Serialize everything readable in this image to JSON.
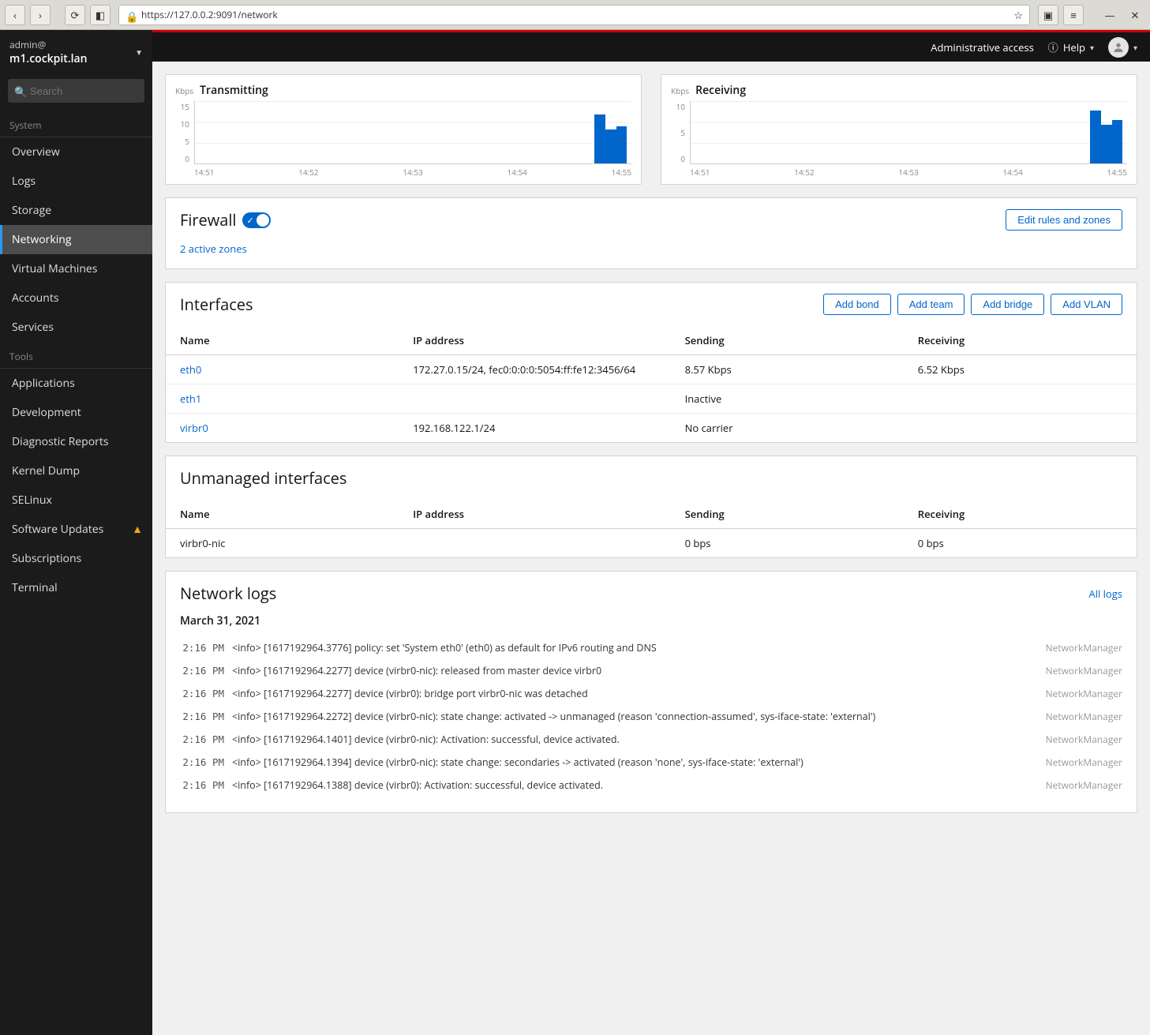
{
  "browser": {
    "url": "https://127.0.0.2:9091/network"
  },
  "topbar": {
    "admin_access": "Administrative access",
    "help": "Help"
  },
  "host": {
    "user": "admin@",
    "hostname": "m1.cockpit.lan"
  },
  "search": {
    "placeholder": "Search"
  },
  "nav": {
    "section_system": "System",
    "overview": "Overview",
    "logs": "Logs",
    "storage": "Storage",
    "networking": "Networking",
    "virtual_machines": "Virtual Machines",
    "accounts": "Accounts",
    "services": "Services",
    "section_tools": "Tools",
    "applications": "Applications",
    "development": "Development",
    "diagnostic_reports": "Diagnostic Reports",
    "kernel_dump": "Kernel Dump",
    "selinux": "SELinux",
    "software_updates": "Software Updates",
    "subscriptions": "Subscriptions",
    "terminal": "Terminal"
  },
  "charts": {
    "unit": "Kbps",
    "tx_title": "Transmitting",
    "rx_title": "Receiving",
    "x_ticks": [
      "14:51",
      "14:52",
      "14:53",
      "14:54",
      "14:55"
    ],
    "tx_y_ticks": [
      "15",
      "10",
      "5",
      "0"
    ],
    "rx_y_ticks": [
      "10",
      "5",
      "0"
    ]
  },
  "chart_data": [
    {
      "type": "area",
      "title": "Transmitting",
      "ylabel": "Kbps",
      "ylim": [
        0,
        15
      ],
      "x_ticks": [
        "14:51",
        "14:52",
        "14:53",
        "14:54",
        "14:55"
      ],
      "series": [
        {
          "name": "tx",
          "spikes": [
            {
              "t": "14:55:30",
              "v": 12
            },
            {
              "t": "14:55:40",
              "v": 8
            },
            {
              "t": "14:55:50",
              "v": 9
            }
          ]
        }
      ]
    },
    {
      "type": "area",
      "title": "Receiving",
      "ylabel": "Kbps",
      "ylim": [
        0,
        10
      ],
      "x_ticks": [
        "14:51",
        "14:52",
        "14:53",
        "14:54",
        "14:55"
      ],
      "series": [
        {
          "name": "rx",
          "spikes": [
            {
              "t": "14:55:30",
              "v": 8.5
            },
            {
              "t": "14:55:40",
              "v": 6
            },
            {
              "t": "14:55:50",
              "v": 7
            }
          ]
        }
      ]
    }
  ],
  "firewall": {
    "title": "Firewall",
    "zones_link": "2 active zones",
    "edit_btn": "Edit rules and zones"
  },
  "interfaces": {
    "title": "Interfaces",
    "add_bond": "Add bond",
    "add_team": "Add team",
    "add_bridge": "Add bridge",
    "add_vlan": "Add VLAN",
    "headers": {
      "name": "Name",
      "ip": "IP address",
      "sending": "Sending",
      "receiving": "Receiving"
    },
    "rows": [
      {
        "name": "eth0",
        "ip": "172.27.0.15/24, fec0:0:0:0:5054:ff:fe12:3456/64",
        "sending": "8.57 Kbps",
        "receiving": "6.52 Kbps"
      },
      {
        "name": "eth1",
        "ip": "",
        "sending": "Inactive",
        "receiving": ""
      },
      {
        "name": "virbr0",
        "ip": "192.168.122.1/24",
        "sending": "No carrier",
        "receiving": ""
      }
    ]
  },
  "unmanaged": {
    "title": "Unmanaged interfaces",
    "headers": {
      "name": "Name",
      "ip": "IP address",
      "sending": "Sending",
      "receiving": "Receiving"
    },
    "rows": [
      {
        "name": "virbr0-nic",
        "ip": "",
        "sending": "0 bps",
        "receiving": "0 bps"
      }
    ]
  },
  "logs": {
    "title": "Network logs",
    "all_logs": "All logs",
    "date": "March 31, 2021",
    "entries": [
      {
        "time": "2:16 PM",
        "msg": "<info> [1617192964.3776] policy: set 'System eth0' (eth0) as default for IPv6 routing and DNS",
        "src": "NetworkManager"
      },
      {
        "time": "2:16 PM",
        "msg": "<info> [1617192964.2277] device (virbr0-nic): released from master device virbr0",
        "src": "NetworkManager"
      },
      {
        "time": "2:16 PM",
        "msg": "<info> [1617192964.2277] device (virbr0): bridge port virbr0-nic was detached",
        "src": "NetworkManager"
      },
      {
        "time": "2:16 PM",
        "msg": "<info> [1617192964.2272] device (virbr0-nic): state change: activated -> unmanaged (reason 'connection-assumed', sys-iface-state: 'external')",
        "src": "NetworkManager"
      },
      {
        "time": "2:16 PM",
        "msg": "<info> [1617192964.1401] device (virbr0-nic): Activation: successful, device activated.",
        "src": "NetworkManager"
      },
      {
        "time": "2:16 PM",
        "msg": "<info> [1617192964.1394] device (virbr0-nic): state change: secondaries -> activated (reason 'none', sys-iface-state: 'external')",
        "src": "NetworkManager"
      },
      {
        "time": "2:16 PM",
        "msg": "<info> [1617192964.1388] device (virbr0): Activation: successful, device activated.",
        "src": "NetworkManager"
      }
    ]
  }
}
